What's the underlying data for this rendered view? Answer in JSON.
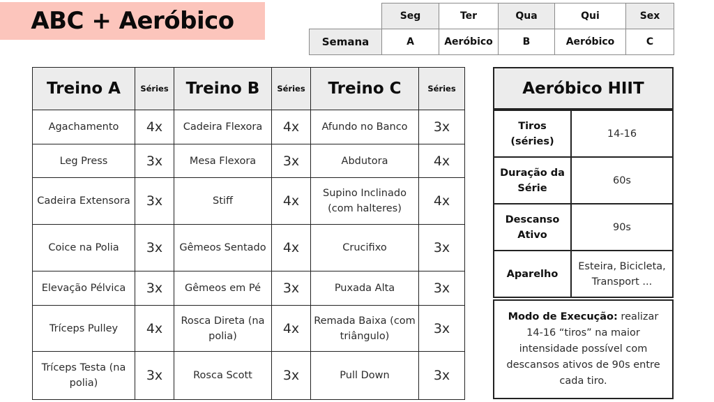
{
  "title": "ABC + Aeróbico",
  "week_schedule": {
    "row_label": "Semana",
    "days": [
      {
        "day": "Seg",
        "workout": "A"
      },
      {
        "day": "Ter",
        "workout": "Aeróbico"
      },
      {
        "day": "Qua",
        "workout": "B"
      },
      {
        "day": "Qui",
        "workout": "Aeróbico"
      },
      {
        "day": "Sex",
        "workout": "C"
      }
    ]
  },
  "workouts": {
    "headers": {
      "a": "Treino A",
      "b": "Treino B",
      "c": "Treino C",
      "sets": "Séries"
    },
    "rows": [
      {
        "a": "Agachamento",
        "a_sets": "4x",
        "b": "Cadeira Flexora",
        "b_sets": "4x",
        "c": "Afundo no Banco",
        "c_sets": "3x"
      },
      {
        "a": "Leg Press",
        "a_sets": "3x",
        "b": "Mesa Flexora",
        "b_sets": "3x",
        "c": "Abdutora",
        "c_sets": "4x"
      },
      {
        "a": "Cadeira Extensora",
        "a_sets": "3x",
        "b": "Stiff",
        "b_sets": "4x",
        "c": "Supino Inclinado (com halteres)",
        "c_sets": "4x"
      },
      {
        "a": "Coice na Polia",
        "a_sets": "3x",
        "b": "Gêmeos Sentado",
        "b_sets": "4x",
        "c": "Crucifixo",
        "c_sets": "3x"
      },
      {
        "a": "Elevação Pélvica",
        "a_sets": "3x",
        "b": "Gêmeos em Pé",
        "b_sets": "3x",
        "c": "Puxada Alta",
        "c_sets": "3x"
      },
      {
        "a": "Tríceps Pulley",
        "a_sets": "4x",
        "b": "Rosca Direta (na polia)",
        "b_sets": "4x",
        "c": "Remada Baixa (com triângulo)",
        "c_sets": "3x"
      },
      {
        "a": "Tríceps Testa (na polia)",
        "a_sets": "3x",
        "b": "Rosca Scott",
        "b_sets": "3x",
        "c": "Pull Down",
        "c_sets": "3x"
      }
    ]
  },
  "hiit": {
    "title": "Aeróbico HIIT",
    "rows": [
      {
        "label": "Tiros (séries)",
        "value": "14-16"
      },
      {
        "label": "Duração da Série",
        "value": "60s"
      },
      {
        "label": "Descanso Ativo",
        "value": "90s"
      },
      {
        "label": "Aparelho",
        "value": "Esteira, Bicicleta, Transport ..."
      }
    ],
    "execution": {
      "label": "Modo de Execução:",
      "text": " realizar 14-16 “tiros” na maior intensidade possível com descansos ativos de 90s entre cada tiro."
    }
  },
  "colors": {
    "title_bg": "#fcc5bc",
    "header_bg": "#ececec"
  }
}
